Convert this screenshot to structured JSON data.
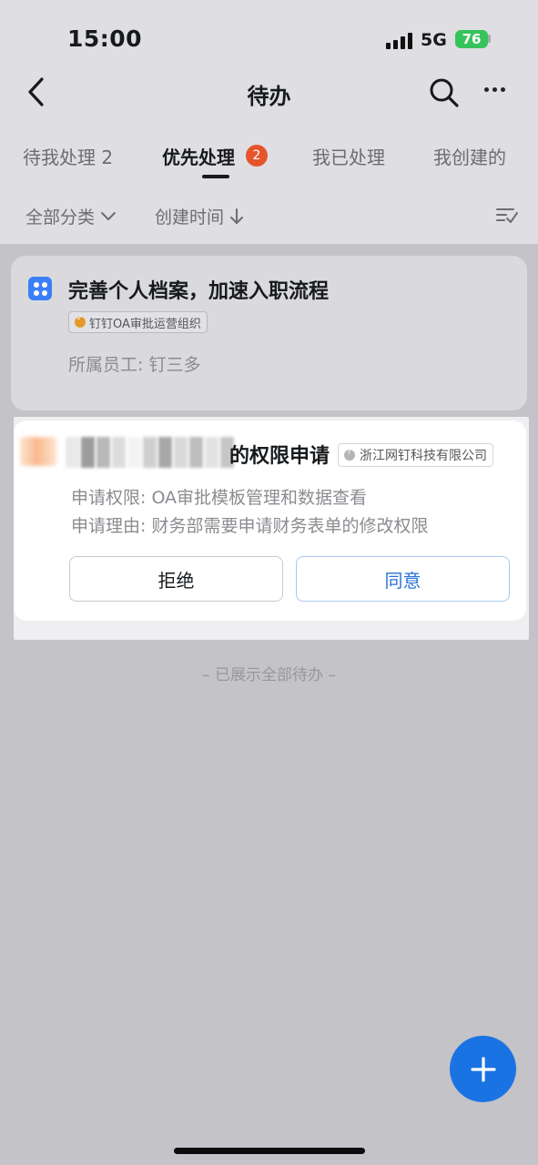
{
  "status_bar": {
    "time": "15:00",
    "network": "5G",
    "battery": "76"
  },
  "nav": {
    "title": "待办",
    "back_icon": "chevron-left-icon",
    "search_icon": "search-icon",
    "more_icon": "more-dots-icon"
  },
  "tabs": [
    {
      "label": "待我处理 2",
      "active": false
    },
    {
      "label": "优先处理",
      "active": true,
      "badge": "2"
    },
    {
      "label": "我已处理",
      "active": false
    },
    {
      "label": "我创建的",
      "active": false
    }
  ],
  "filters": {
    "category": "全部分类",
    "sort": "创建时间",
    "sort_icon": "list-check-icon"
  },
  "tasks": [
    {
      "title": "完善个人档案，加速入职流程",
      "org_tag": "钉钉OA审批运营组织",
      "meta": "所属员工: 钉三多"
    },
    {
      "title_visible": "的权限申请",
      "company_tag": "浙江网钉科技有限公司",
      "details": [
        "申请权限: OA审批模板管理和数据查看",
        "申请理由: 财务部需要申请财务表单的修改权限"
      ],
      "reject_label": "拒绝",
      "approve_label": "同意"
    }
  ],
  "list_end_hint": "– 已展示全部待办 –",
  "colors": {
    "accent": "#1a73e3",
    "badge": "#e5542c",
    "approve_text": "#2a72d6",
    "battery": "#37c35b",
    "overlay": "#c3c3c8"
  }
}
